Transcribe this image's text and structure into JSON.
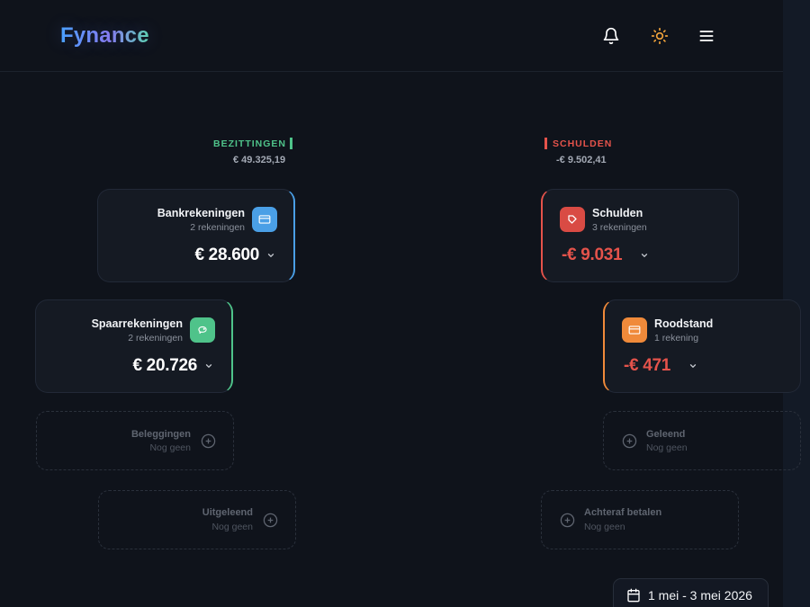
{
  "app": {
    "name": "Fynance"
  },
  "header": {
    "icons": [
      "bell-icon",
      "sun-icon",
      "menu-icon"
    ],
    "sun_color": "#f0a23a"
  },
  "assets": {
    "title": "BEZITTINGEN",
    "total": "€ 49.325,19",
    "accent": "#4fc38a",
    "cards": [
      {
        "title": "Bankrekeningen",
        "sub": "2 rekeningen",
        "amount": "€ 28.600",
        "icon": "card-icon",
        "color": "#4a9fe6"
      },
      {
        "title": "Spaarrekeningen",
        "sub": "2 rekeningen",
        "amount": "€ 20.726",
        "icon": "piggy-bank-icon",
        "color": "#4fc38a"
      }
    ],
    "empty": [
      {
        "title": "Beleggingen",
        "sub": "Nog geen"
      },
      {
        "title": "Uitgeleend",
        "sub": "Nog geen"
      }
    ]
  },
  "debts": {
    "title": "SCHULDEN",
    "total": "-€ 9.502,41",
    "accent": "#e5534b",
    "cards": [
      {
        "title": "Schulden",
        "sub": "3 rekeningen",
        "amount": "-€ 9.031",
        "icon": "tag-icon",
        "color": "#e5534b"
      },
      {
        "title": "Roodstand",
        "sub": "1 rekening",
        "amount": "-€ 471",
        "icon": "card-icon",
        "color": "#f08a3a"
      }
    ],
    "empty": [
      {
        "title": "Geleend",
        "sub": "Nog geen"
      },
      {
        "title": "Achteraf betalen",
        "sub": "Nog geen"
      }
    ]
  },
  "date_range": {
    "label": "1 mei - 3 mei 2026"
  }
}
